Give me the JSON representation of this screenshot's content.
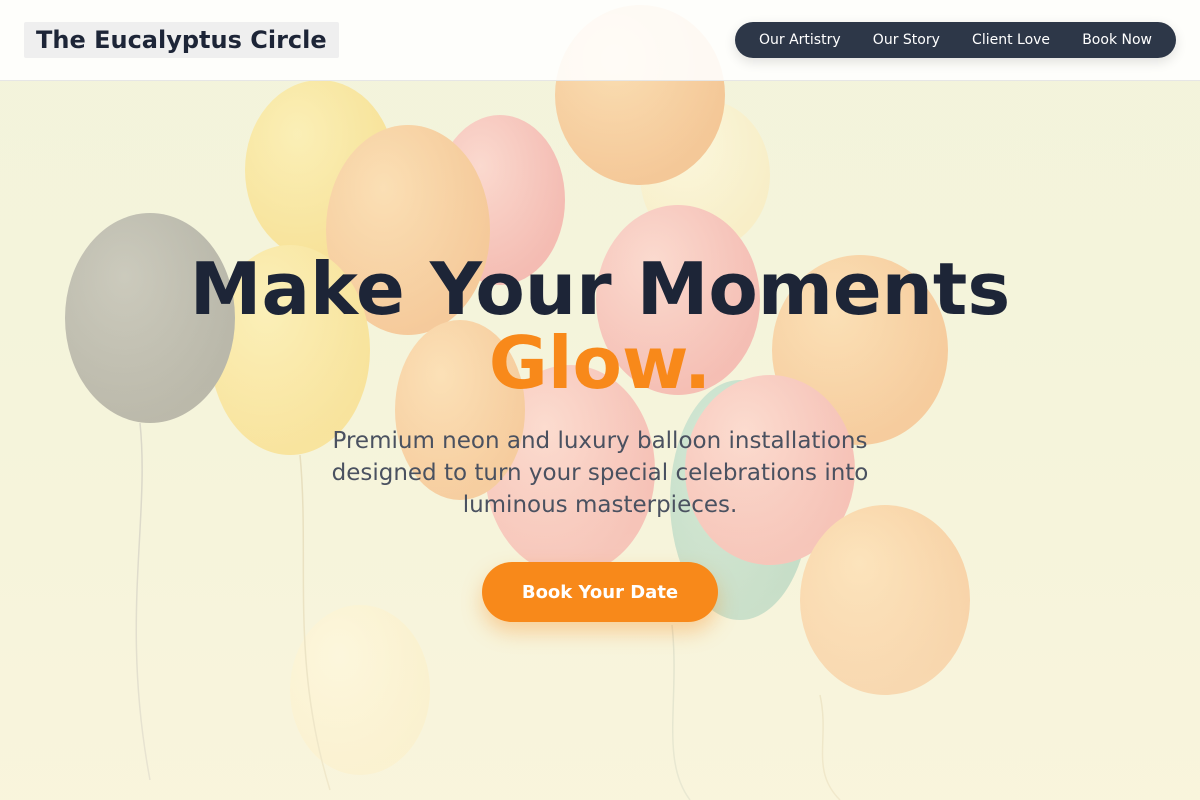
{
  "header": {
    "brand": "The Eucalyptus Circle",
    "nav": [
      "Our Artistry",
      "Our Story",
      "Client Love",
      "Book Now"
    ]
  },
  "hero": {
    "title_line1": "Make Your Moments",
    "title_line2": "Glow.",
    "subtitle": "Premium neon and luxury balloon installations designed to turn your special celebrations into luminous masterpieces.",
    "cta_label": "Book Your Date"
  },
  "colors": {
    "accent": "#f8891a",
    "heading": "#1d2537",
    "nav_background": "#2d3748"
  }
}
